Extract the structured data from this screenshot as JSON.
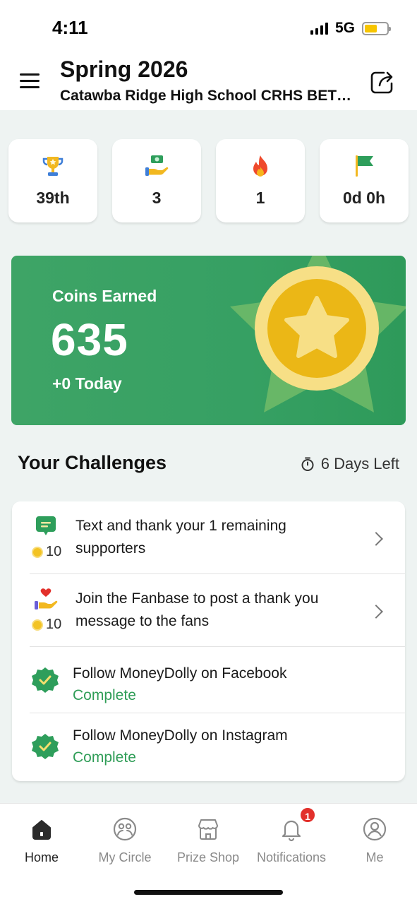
{
  "status_bar": {
    "time": "4:11",
    "network": "5G"
  },
  "header": {
    "title": "Spring 2026",
    "subtitle": "Catawba Ridge High School CRHS BET…"
  },
  "stats": [
    {
      "icon": "trophy-icon",
      "value": "39th"
    },
    {
      "icon": "hand-money-icon",
      "value": "3"
    },
    {
      "icon": "flame-icon",
      "value": "1"
    },
    {
      "icon": "flag-icon",
      "value": "0d 0h"
    }
  ],
  "coins": {
    "label": "Coins Earned",
    "value": "635",
    "today": "+0 Today"
  },
  "challenges": {
    "title": "Your Challenges",
    "days_left": "6 Days Left",
    "items": [
      {
        "icon": "chat-icon",
        "text": "Text and thank your 1 remaining supporters",
        "reward": "10"
      },
      {
        "icon": "heart-hand-icon",
        "text": "Join the Fanbase to post a thank you message to the fans",
        "reward": "10"
      },
      {
        "icon": "check-badge-icon",
        "text": "Follow MoneyDolly on Facebook",
        "status": "Complete"
      },
      {
        "icon": "check-badge-icon",
        "text": "Follow MoneyDolly on Instagram",
        "status": "Complete"
      }
    ]
  },
  "nav": {
    "items": [
      {
        "label": "Home",
        "icon": "home-icon",
        "active": true
      },
      {
        "label": "My Circle",
        "icon": "circle-people-icon"
      },
      {
        "label": "Prize Shop",
        "icon": "shop-icon"
      },
      {
        "label": "Notifications",
        "icon": "bell-icon",
        "badge": "1"
      },
      {
        "label": "Me",
        "icon": "user-icon"
      }
    ]
  },
  "colors": {
    "brand_green": "#3ea466",
    "complete_green": "#2f9d57",
    "coin_gold": "#f3c324",
    "badge_red": "#e2302b"
  }
}
